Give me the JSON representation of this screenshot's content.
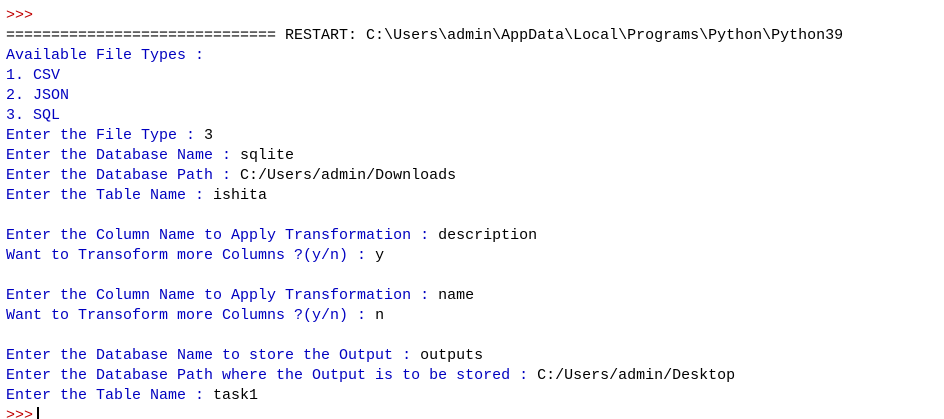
{
  "shell": {
    "lines": [
      {
        "kind": "io",
        "out": "Enter the Table Name : ",
        "in": "ishita"
      },
      {
        "kind": "prompt",
        "text": ">>>"
      },
      {
        "kind": "plain",
        "text": "============================== RESTART: C:\\Users\\admin\\AppData\\Local\\Programs\\Python\\Python39"
      },
      {
        "kind": "out",
        "text": "Available File Types :"
      },
      {
        "kind": "out",
        "text": "1. CSV"
      },
      {
        "kind": "out",
        "text": "2. JSON"
      },
      {
        "kind": "out",
        "text": "3. SQL"
      },
      {
        "kind": "io",
        "out": "Enter the File Type : ",
        "in": "3"
      },
      {
        "kind": "io",
        "out": "Enter the Database Name : ",
        "in": "sqlite"
      },
      {
        "kind": "io",
        "out": "Enter the Database Path : ",
        "in": "C:/Users/admin/Downloads"
      },
      {
        "kind": "io",
        "out": "Enter the Table Name : ",
        "in": "ishita"
      },
      {
        "kind": "blank",
        "text": ""
      },
      {
        "kind": "io",
        "out": "Enter the Column Name to Apply Transformation : ",
        "in": "description"
      },
      {
        "kind": "io",
        "out": "Want to Transoform more Columns ?(y/n) : ",
        "in": "y"
      },
      {
        "kind": "blank",
        "text": ""
      },
      {
        "kind": "io",
        "out": "Enter the Column Name to Apply Transformation : ",
        "in": "name"
      },
      {
        "kind": "io",
        "out": "Want to Transoform more Columns ?(y/n) : ",
        "in": "n"
      },
      {
        "kind": "blank",
        "text": ""
      },
      {
        "kind": "io",
        "out": "Enter the Database Name to store the Output : ",
        "in": "outputs"
      },
      {
        "kind": "io",
        "out": "Enter the Database Path where the Output is to be stored : ",
        "in": "C:/Users/admin/Desktop"
      },
      {
        "kind": "io",
        "out": "Enter the Table Name : ",
        "in": "task1"
      },
      {
        "kind": "cursor-prompt",
        "text": ">>>"
      }
    ]
  },
  "colors": {
    "prompt": "#c00000",
    "program_output": "#0000c0",
    "user_input": "#000000",
    "background": "#ffffff"
  }
}
